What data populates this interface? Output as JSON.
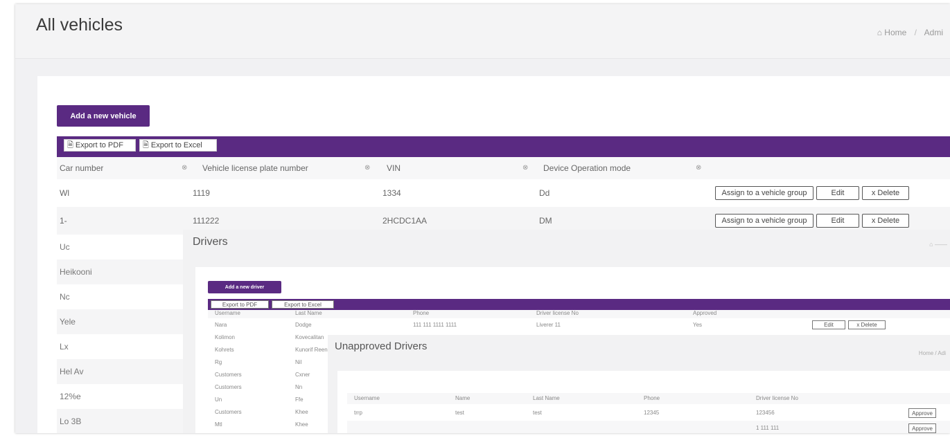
{
  "page": {
    "title": "All vehicles"
  },
  "breadcrumb": {
    "home": "Home",
    "sep": "/",
    "current": "Admi"
  },
  "vehicles": {
    "add_button": "Add a new vehicle",
    "export_pdf": "Export to PDF",
    "export_excel": "Export to Excel",
    "columns": [
      "Car number",
      "Vehicle license plate number",
      "VIN",
      "Device Operation mode"
    ],
    "filter_icon": "filter-icon",
    "rows": [
      {
        "car_number": "Wl",
        "plate": "1119",
        "vin": "1334",
        "mode": "Dd"
      },
      {
        "car_number": "1-",
        "plate": "111222",
        "vin": "2HCDC1AA",
        "mode": "DM"
      }
    ],
    "row_actions": {
      "assign": "Assign to a vehicle group",
      "edit": "Edit",
      "delete": "x Delete"
    },
    "left_column_more": [
      "Uc",
      "Heikooni",
      "Nc",
      "Yele",
      "Lx",
      "Hel Av",
      "12%e",
      "Lo 3B"
    ]
  },
  "drivers": {
    "title": "Drivers",
    "add_button": "Add a new driver",
    "export_pdf": "Export to PDF",
    "export_excel": "Export to Excel",
    "columns": [
      "Username",
      "Last Name",
      "Phone",
      "Driver license No",
      "Approved"
    ],
    "rows": [
      {
        "c1": "Nara",
        "c2": "Dodge",
        "c3": "111 111 1111 1111",
        "c4": "Liverer 11",
        "c5": "Yes"
      },
      {
        "c1": "Kolimon",
        "c2": "Kovecalitan",
        "c3": "",
        "c4": "",
        "c5": ""
      },
      {
        "c1": "Kohrets",
        "c2": "Kunorif Reen",
        "c3": "",
        "c4": "",
        "c5": ""
      },
      {
        "c1": "Rg",
        "c2": "Nil",
        "c3": "",
        "c4": "",
        "c5": ""
      },
      {
        "c1": "Customers",
        "c2": "Cxner",
        "c3": "",
        "c4": "",
        "c5": ""
      },
      {
        "c1": "Customers",
        "c2": "Nn",
        "c3": "",
        "c4": "",
        "c5": ""
      },
      {
        "c1": "Un",
        "c2": "Ffe",
        "c3": "",
        "c4": "",
        "c5": ""
      },
      {
        "c1": "Customers",
        "c2": "Khee",
        "c3": "",
        "c4": "",
        "c5": ""
      },
      {
        "c1": "Mtl",
        "c2": "Khee",
        "c3": "",
        "c4": "",
        "c5": ""
      }
    ],
    "actions": {
      "edit": "Edit",
      "delete": "x Delete"
    }
  },
  "unapproved": {
    "title": "Unapproved Drivers",
    "crumb": "Home / Adi",
    "columns": [
      "Username",
      "Name",
      "Last Name",
      "Phone",
      "Driver license No"
    ],
    "rows": [
      {
        "username": "trrp",
        "name": "test",
        "last": "test",
        "phone": "12345",
        "license": "123456"
      },
      {
        "username": "",
        "name": "",
        "last": "",
        "phone": "",
        "license": "1 111 111"
      }
    ],
    "action": "Approve"
  },
  "colors": {
    "accent": "#5a2a82"
  }
}
